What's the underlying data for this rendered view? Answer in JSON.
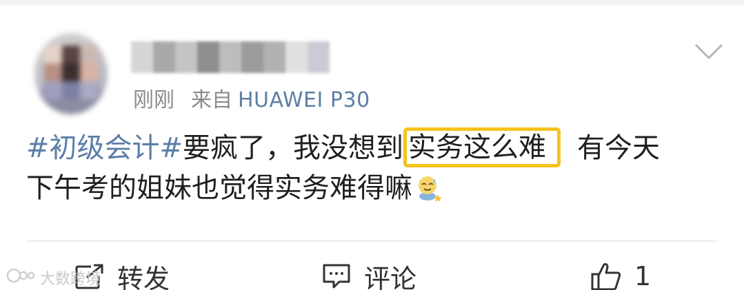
{
  "post": {
    "time": "刚刚",
    "source_prefix": "来自",
    "device": "HUAWEI P30",
    "topic": "#初级会计#",
    "text_before_highlight": "要疯了，我没想到",
    "highlight_text": "实务这么难",
    "text_after_highlight": "有今天",
    "line2": "下午考的姐妹也觉得实务难得嘛",
    "emoji_icon": "sweat-smile-emoji-icon",
    "highlight_color": "#f6c31c",
    "link_color": "#5b7ea8"
  },
  "actions": {
    "repost_label": "转发",
    "comment_label": "评论",
    "like_count": "1"
  },
  "watermark": {
    "text": "大数跨境"
  }
}
